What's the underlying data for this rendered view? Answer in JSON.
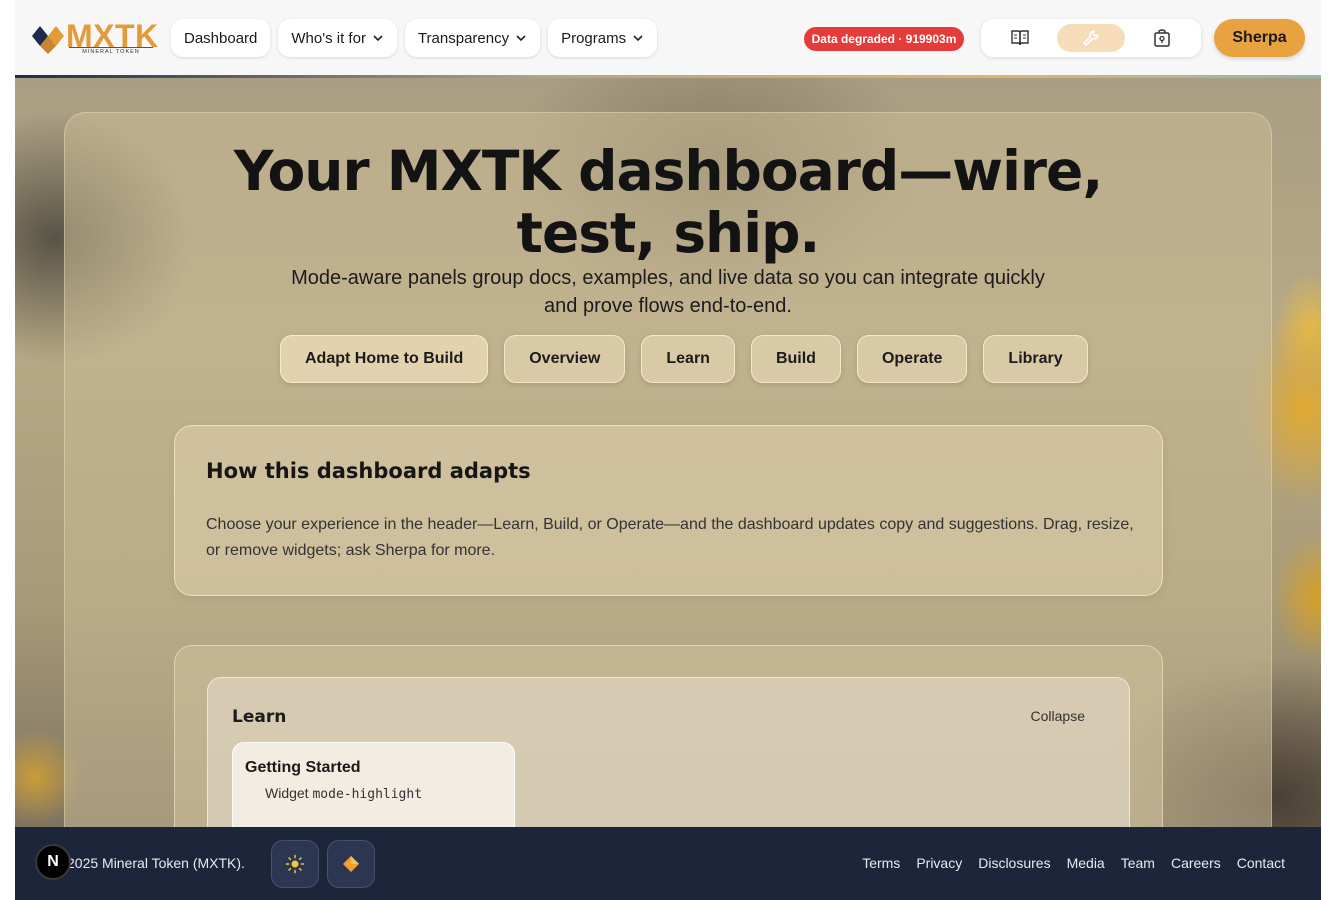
{
  "header": {
    "logo_text": "MXTK",
    "logo_subtext": "MINERAL TOKEN",
    "nav": [
      {
        "label": "Dashboard",
        "has_menu": false
      },
      {
        "label": "Who's it for",
        "has_menu": true
      },
      {
        "label": "Transparency",
        "has_menu": true
      },
      {
        "label": "Programs",
        "has_menu": true
      }
    ],
    "status_badge": "Data degraded · 919903m",
    "mode_icons": [
      "book-icon",
      "wrench-icon",
      "vault-icon"
    ],
    "active_mode": "wrench-icon",
    "sherpa_label": "Sherpa"
  },
  "hero": {
    "title": "Your MXTK dashboard—wire, test, ship.",
    "subtitle": "Mode-aware panels group docs, examples, and live data so you can integrate quickly and prove flows end-to-end.",
    "buttons": [
      "Adapt Home to Build",
      "Overview",
      "Learn",
      "Build",
      "Operate",
      "Library"
    ]
  },
  "adapt": {
    "title": "How this dashboard adapts",
    "text": "Choose your experience in the header—Learn, Build, or Operate—and the dashboard updates copy and suggestions. Drag, resize, or remove widgets; ask Sherpa for more."
  },
  "learn_section": {
    "title": "Learn",
    "collapse_label": "Collapse",
    "widget": {
      "title": "Getting Started",
      "sub_prefix": "Widget",
      "sub_code": "mode-highlight"
    }
  },
  "footer": {
    "n_badge": "N",
    "copyright": "2025 Mineral Token (MXTK).",
    "links": [
      "Terms",
      "Privacy",
      "Disclosures",
      "Media",
      "Team",
      "Careers",
      "Contact"
    ]
  },
  "colors": {
    "brand_orange": "#e8a240",
    "badge_red": "#e53b3b",
    "footer_bg": "#1c2539"
  }
}
